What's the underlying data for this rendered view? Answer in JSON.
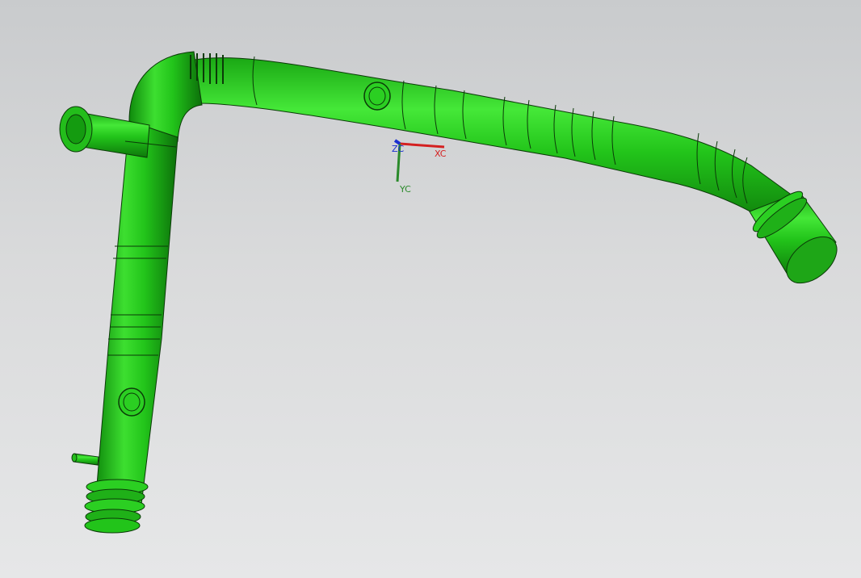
{
  "viewport": {
    "background_top": "#c9cbcd",
    "background_bottom": "#e6e7e8"
  },
  "model": {
    "body_color": "#22c41a",
    "highlight_color": "#5cf04f",
    "shade_color": "#0f7d0c",
    "edge_color": "#0b3a08"
  },
  "triad": {
    "x_label": "XC",
    "y_label": "YC",
    "z_label": "ZC",
    "x_color": "#d42020",
    "y_color": "#2a8a2a",
    "z_color": "#1a2fd0"
  }
}
